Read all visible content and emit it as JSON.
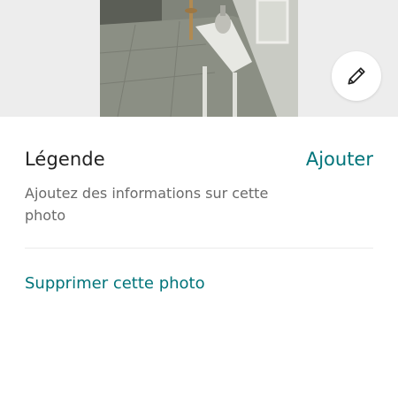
{
  "photo": {
    "edit_icon": "pencil-icon"
  },
  "caption": {
    "title": "Légende",
    "add_label": "Ajouter",
    "description": "Ajoutez des informations sur cette photo"
  },
  "actions": {
    "delete_label": "Supprimer cette photo"
  },
  "colors": {
    "accent": "#00747a",
    "text_primary": "#222222",
    "text_secondary": "#6a6a6a"
  }
}
